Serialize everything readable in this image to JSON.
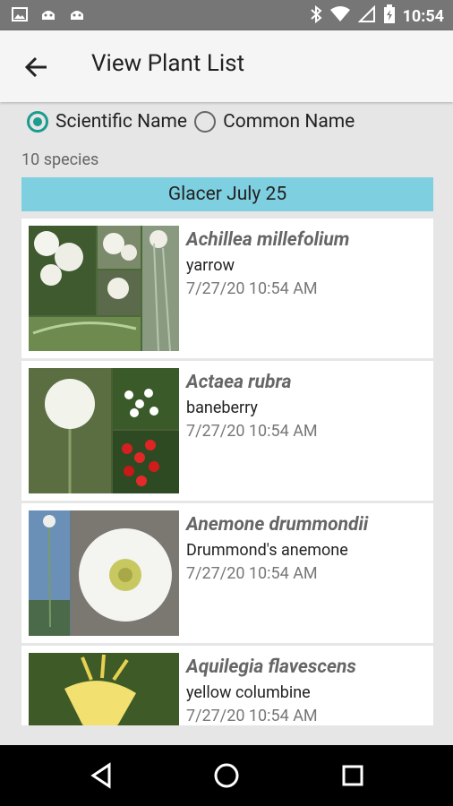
{
  "status_bar": {
    "time": "10:54"
  },
  "app_bar": {
    "title": "View Plant List"
  },
  "sort_options": [
    {
      "label": "Scientific Name",
      "selected": true
    },
    {
      "label": "Common Name",
      "selected": false
    }
  ],
  "species_count": "10 species",
  "group": {
    "title": "Glacer July 25"
  },
  "plants": [
    {
      "scientific": "Achillea millefolium",
      "common": "yarrow",
      "date": "7/27/20 10:54 AM"
    },
    {
      "scientific": "Actaea rubra",
      "common": "baneberry",
      "date": "7/27/20 10:54 AM"
    },
    {
      "scientific": "Anemone drummondii",
      "common": "Drummond's anemone",
      "date": "7/27/20 10:54 AM"
    },
    {
      "scientific": "Aquilegia flavescens",
      "common": "yellow columbine",
      "date": "7/27/20 10:54 AM"
    }
  ],
  "colors": {
    "accent": "#1a9c8f",
    "group_header": "#7ecfe0",
    "status_bar": "#767676"
  }
}
